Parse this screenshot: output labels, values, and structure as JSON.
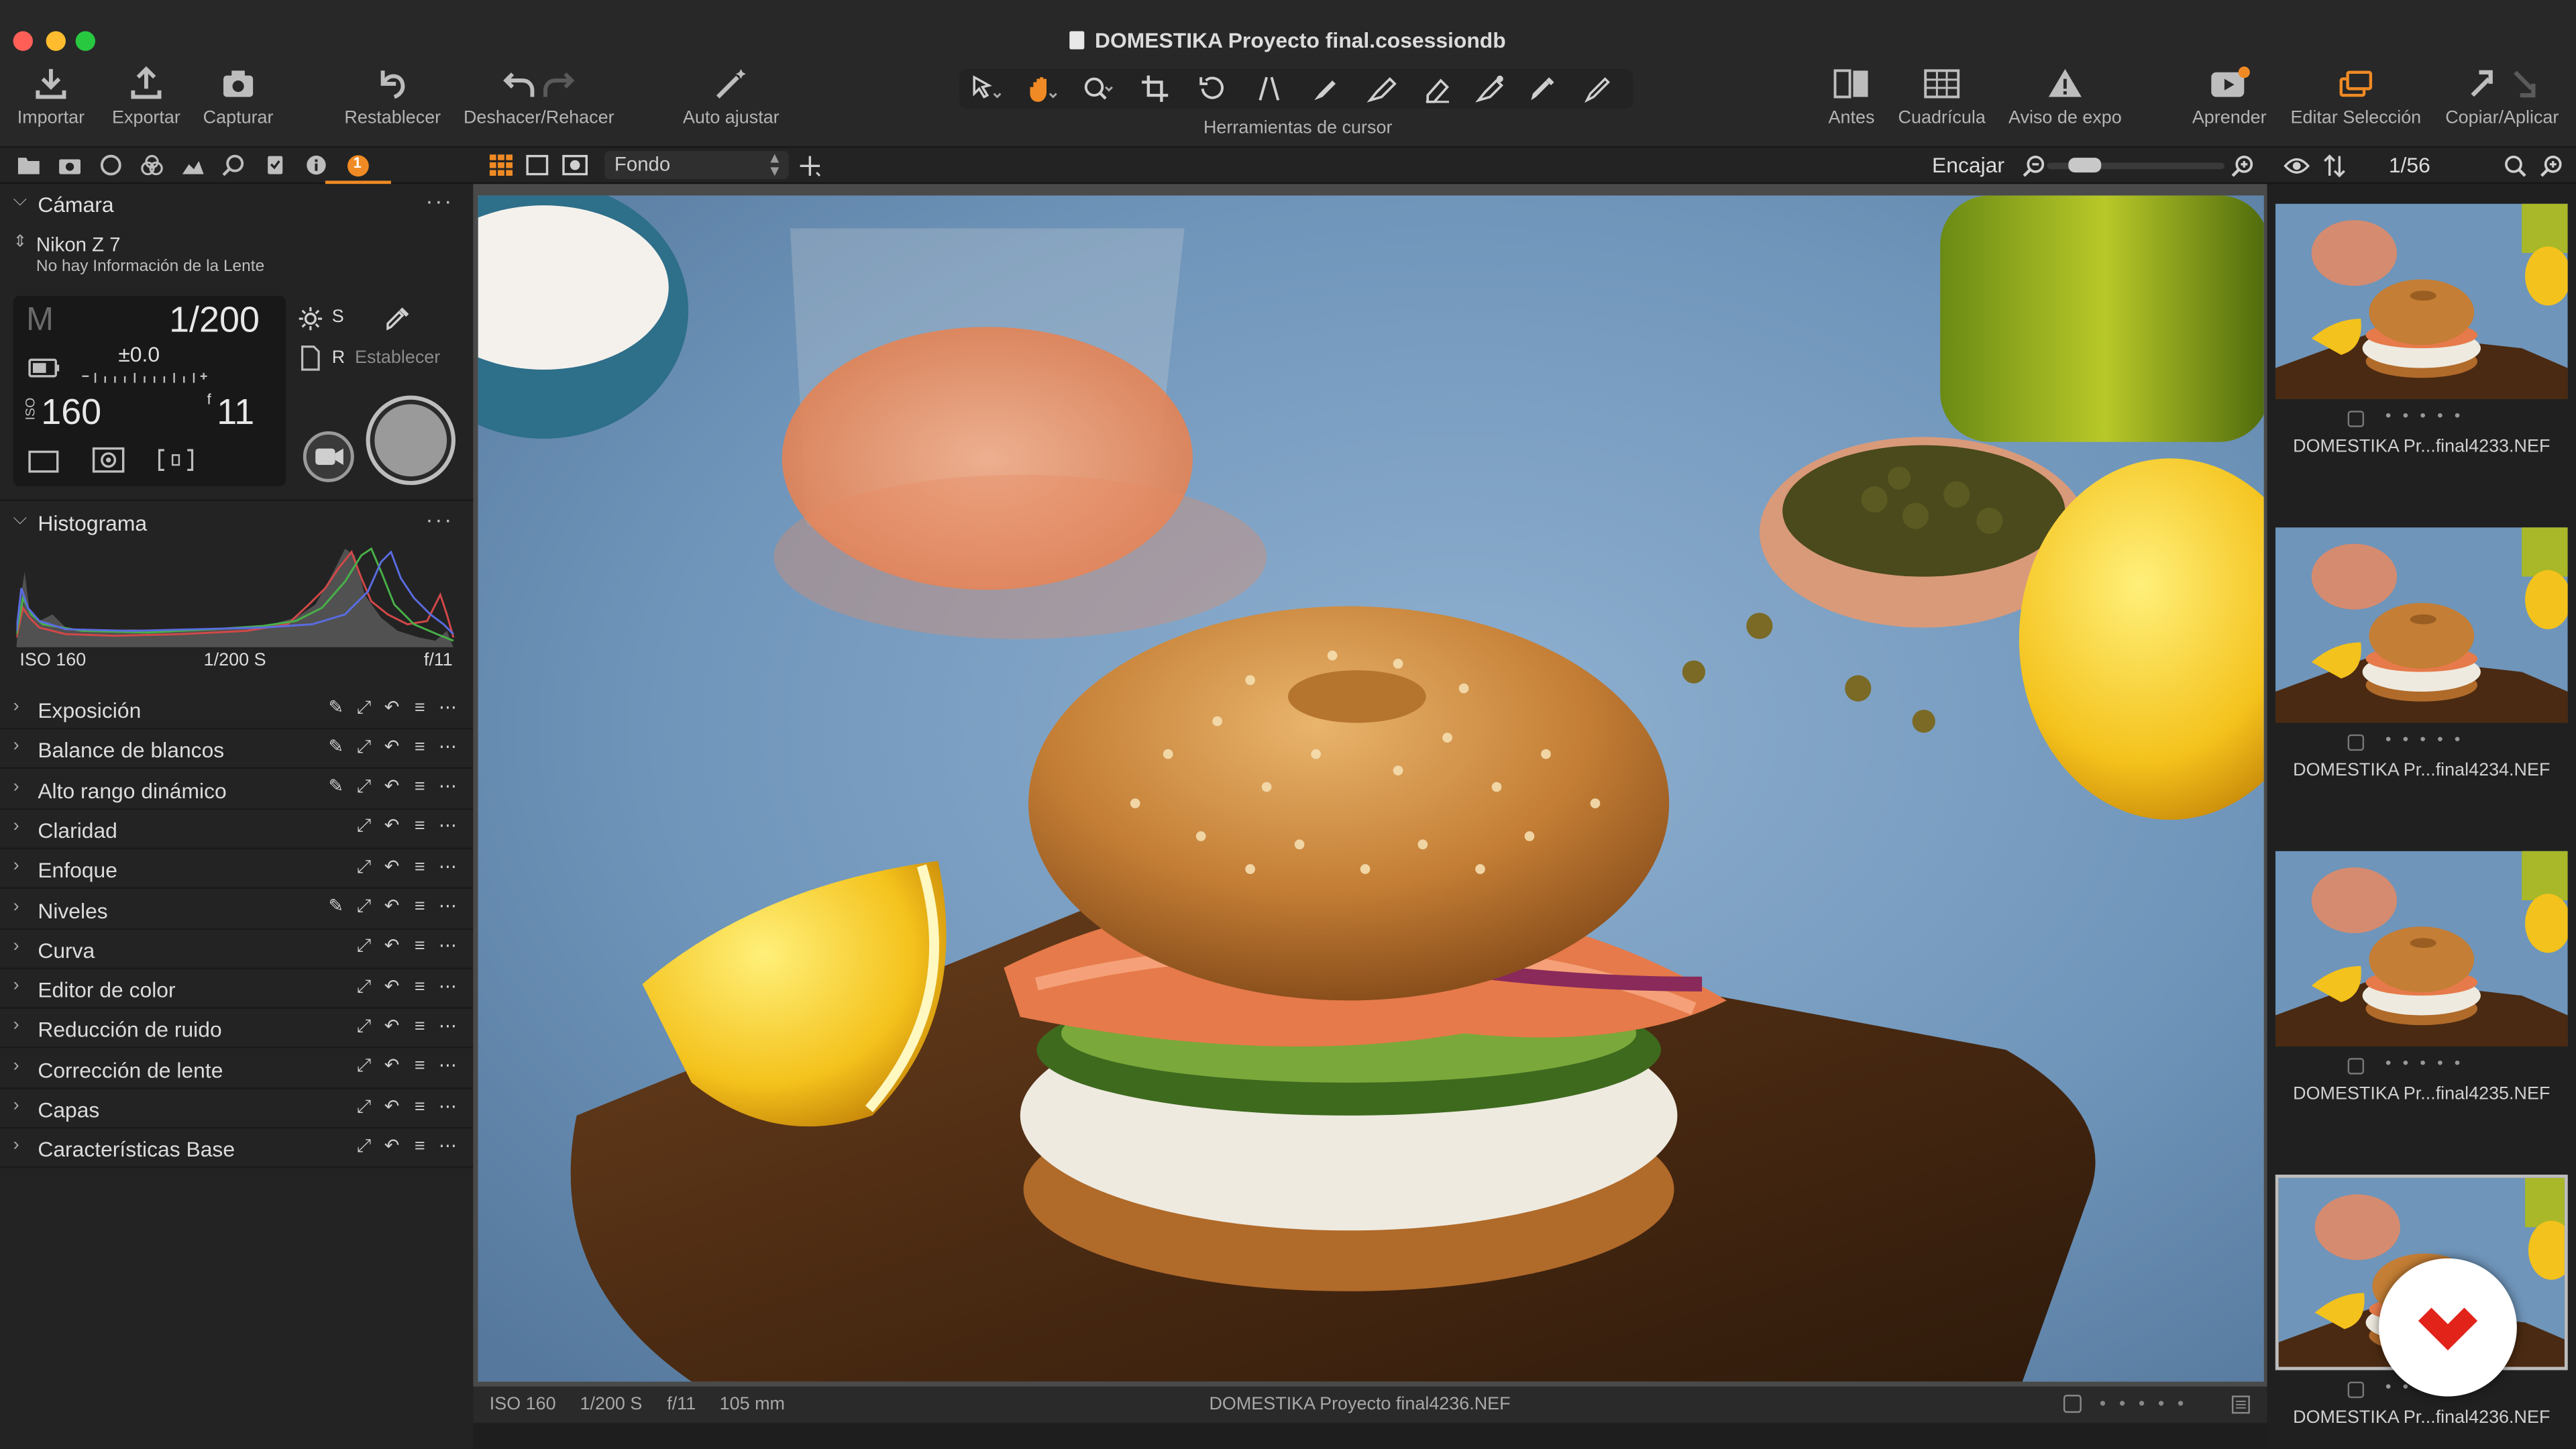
{
  "window": {
    "title": "DOMESTIKA Proyecto final.cosessiondb",
    "traffic_lights": {
      "close": "#ff5f57",
      "minimize": "#febc2e",
      "maximize": "#28c840"
    }
  },
  "toolbar": {
    "import": "Importar",
    "export": "Exportar",
    "capture": "Capturar",
    "reset": "Restablecer",
    "undo_redo": "Deshacer/Rehacer",
    "auto_adjust": "Auto ajustar",
    "cursor_tools": "Herramientas de cursor",
    "before": "Antes",
    "grid": "Cuadrícula",
    "exposure_warning": "Aviso de expo",
    "learn": "Aprender",
    "edit_selection": "Editar Selección",
    "copy_apply": "Copiar/Aplicar",
    "accent_color": "#f08a24"
  },
  "left_tabs": {
    "badge": "1"
  },
  "camera": {
    "section_title": "Cámara",
    "model": "Nikon Z 7",
    "lens": "No hay Información de la Lente",
    "mode": "M",
    "shutter": "1/200",
    "exposure_comp": "±0.0",
    "iso": "160",
    "aperture": "11",
    "white_balance_label": "S",
    "recipe_label": "R",
    "set_label": "Establecer"
  },
  "histogram": {
    "section_title": "Histograma",
    "iso": "ISO 160",
    "shutter": "1/200 S",
    "aperture": "f/11"
  },
  "tools": [
    {
      "name": "Exposición",
      "picker": true
    },
    {
      "name": "Balance de blancos",
      "picker": true
    },
    {
      "name": "Alto rango dinámico",
      "picker": true
    },
    {
      "name": "Claridad",
      "picker": false
    },
    {
      "name": "Enfoque",
      "picker": false
    },
    {
      "name": "Niveles",
      "picker": true
    },
    {
      "name": "Curva",
      "picker": false
    },
    {
      "name": "Editor de color",
      "picker": false
    },
    {
      "name": "Reducción de ruido",
      "picker": false
    },
    {
      "name": "Corrección de lente",
      "picker": false
    },
    {
      "name": "Capas",
      "picker": false
    },
    {
      "name": "Características Base",
      "picker": false
    }
  ],
  "viewer": {
    "style_select": "Fondo",
    "zoom_label": "Encajar",
    "zoom_level": 0.15,
    "status": {
      "iso": "ISO 160",
      "shutter": "1/200 S",
      "aperture": "f/11",
      "focal": "105 mm",
      "filename": "DOMESTIKA Proyecto final4236.NEF"
    }
  },
  "browser": {
    "count": "1/56",
    "thumbnails": [
      {
        "label": "DOMESTIKA Pr...final4233.NEF",
        "selected": false
      },
      {
        "label": "DOMESTIKA Pr...final4234.NEF",
        "selected": false
      },
      {
        "label": "DOMESTIKA Pr...final4235.NEF",
        "selected": false
      },
      {
        "label": "DOMESTIKA Pr...final4236.NEF",
        "selected": true
      }
    ]
  }
}
